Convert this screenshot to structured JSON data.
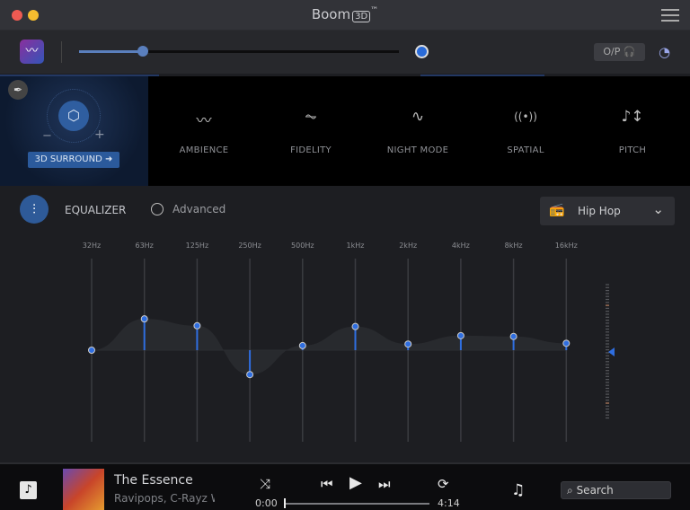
{
  "window": {
    "title": "Boom",
    "title_badge": "3D",
    "title_tm": "™"
  },
  "toolbar": {
    "volume_percent": 20,
    "output_label": "O/P",
    "output_icon": "headphones-icon"
  },
  "effects": {
    "surround": {
      "label": "3D SURROUND ➜",
      "minus": "−",
      "plus": "+"
    },
    "items": [
      {
        "label": "AMBIENCE",
        "icon": "ambience-icon",
        "glyph": "〰"
      },
      {
        "label": "FIDELITY",
        "icon": "fidelity-icon",
        "glyph": "⏦"
      },
      {
        "label": "NIGHT MODE",
        "icon": "night-mode-icon",
        "glyph": "∿"
      },
      {
        "label": "SPATIAL",
        "icon": "spatial-icon",
        "glyph": "((•))"
      },
      {
        "label": "PITCH",
        "icon": "pitch-icon",
        "glyph": "♪↕"
      }
    ]
  },
  "equalizer": {
    "label": "EQUALIZER",
    "advanced_label": "Advanced",
    "preset": "Hip Hop",
    "accent": "#2f6ee0",
    "range_db": [
      -12,
      12
    ],
    "bands": [
      {
        "label": "32Hz",
        "gain": 0
      },
      {
        "label": "63Hz",
        "gain": 4.1
      },
      {
        "label": "125Hz",
        "gain": 3.2
      },
      {
        "label": "250Hz",
        "gain": -3.2
      },
      {
        "label": "500Hz",
        "gain": 0.6
      },
      {
        "label": "1kHz",
        "gain": 3.1
      },
      {
        "label": "2kHz",
        "gain": 0.8
      },
      {
        "label": "4kHz",
        "gain": 1.9
      },
      {
        "label": "8kHz",
        "gain": 1.8
      },
      {
        "label": "16kHz",
        "gain": 0.9
      }
    ],
    "preamp_gain": 0
  },
  "player": {
    "title": "The Essence",
    "artist": "Ravipops, C-Rayz Walz",
    "elapsed": "0:00",
    "duration": "4:14",
    "progress": 0,
    "search_placeholder": "Search"
  }
}
